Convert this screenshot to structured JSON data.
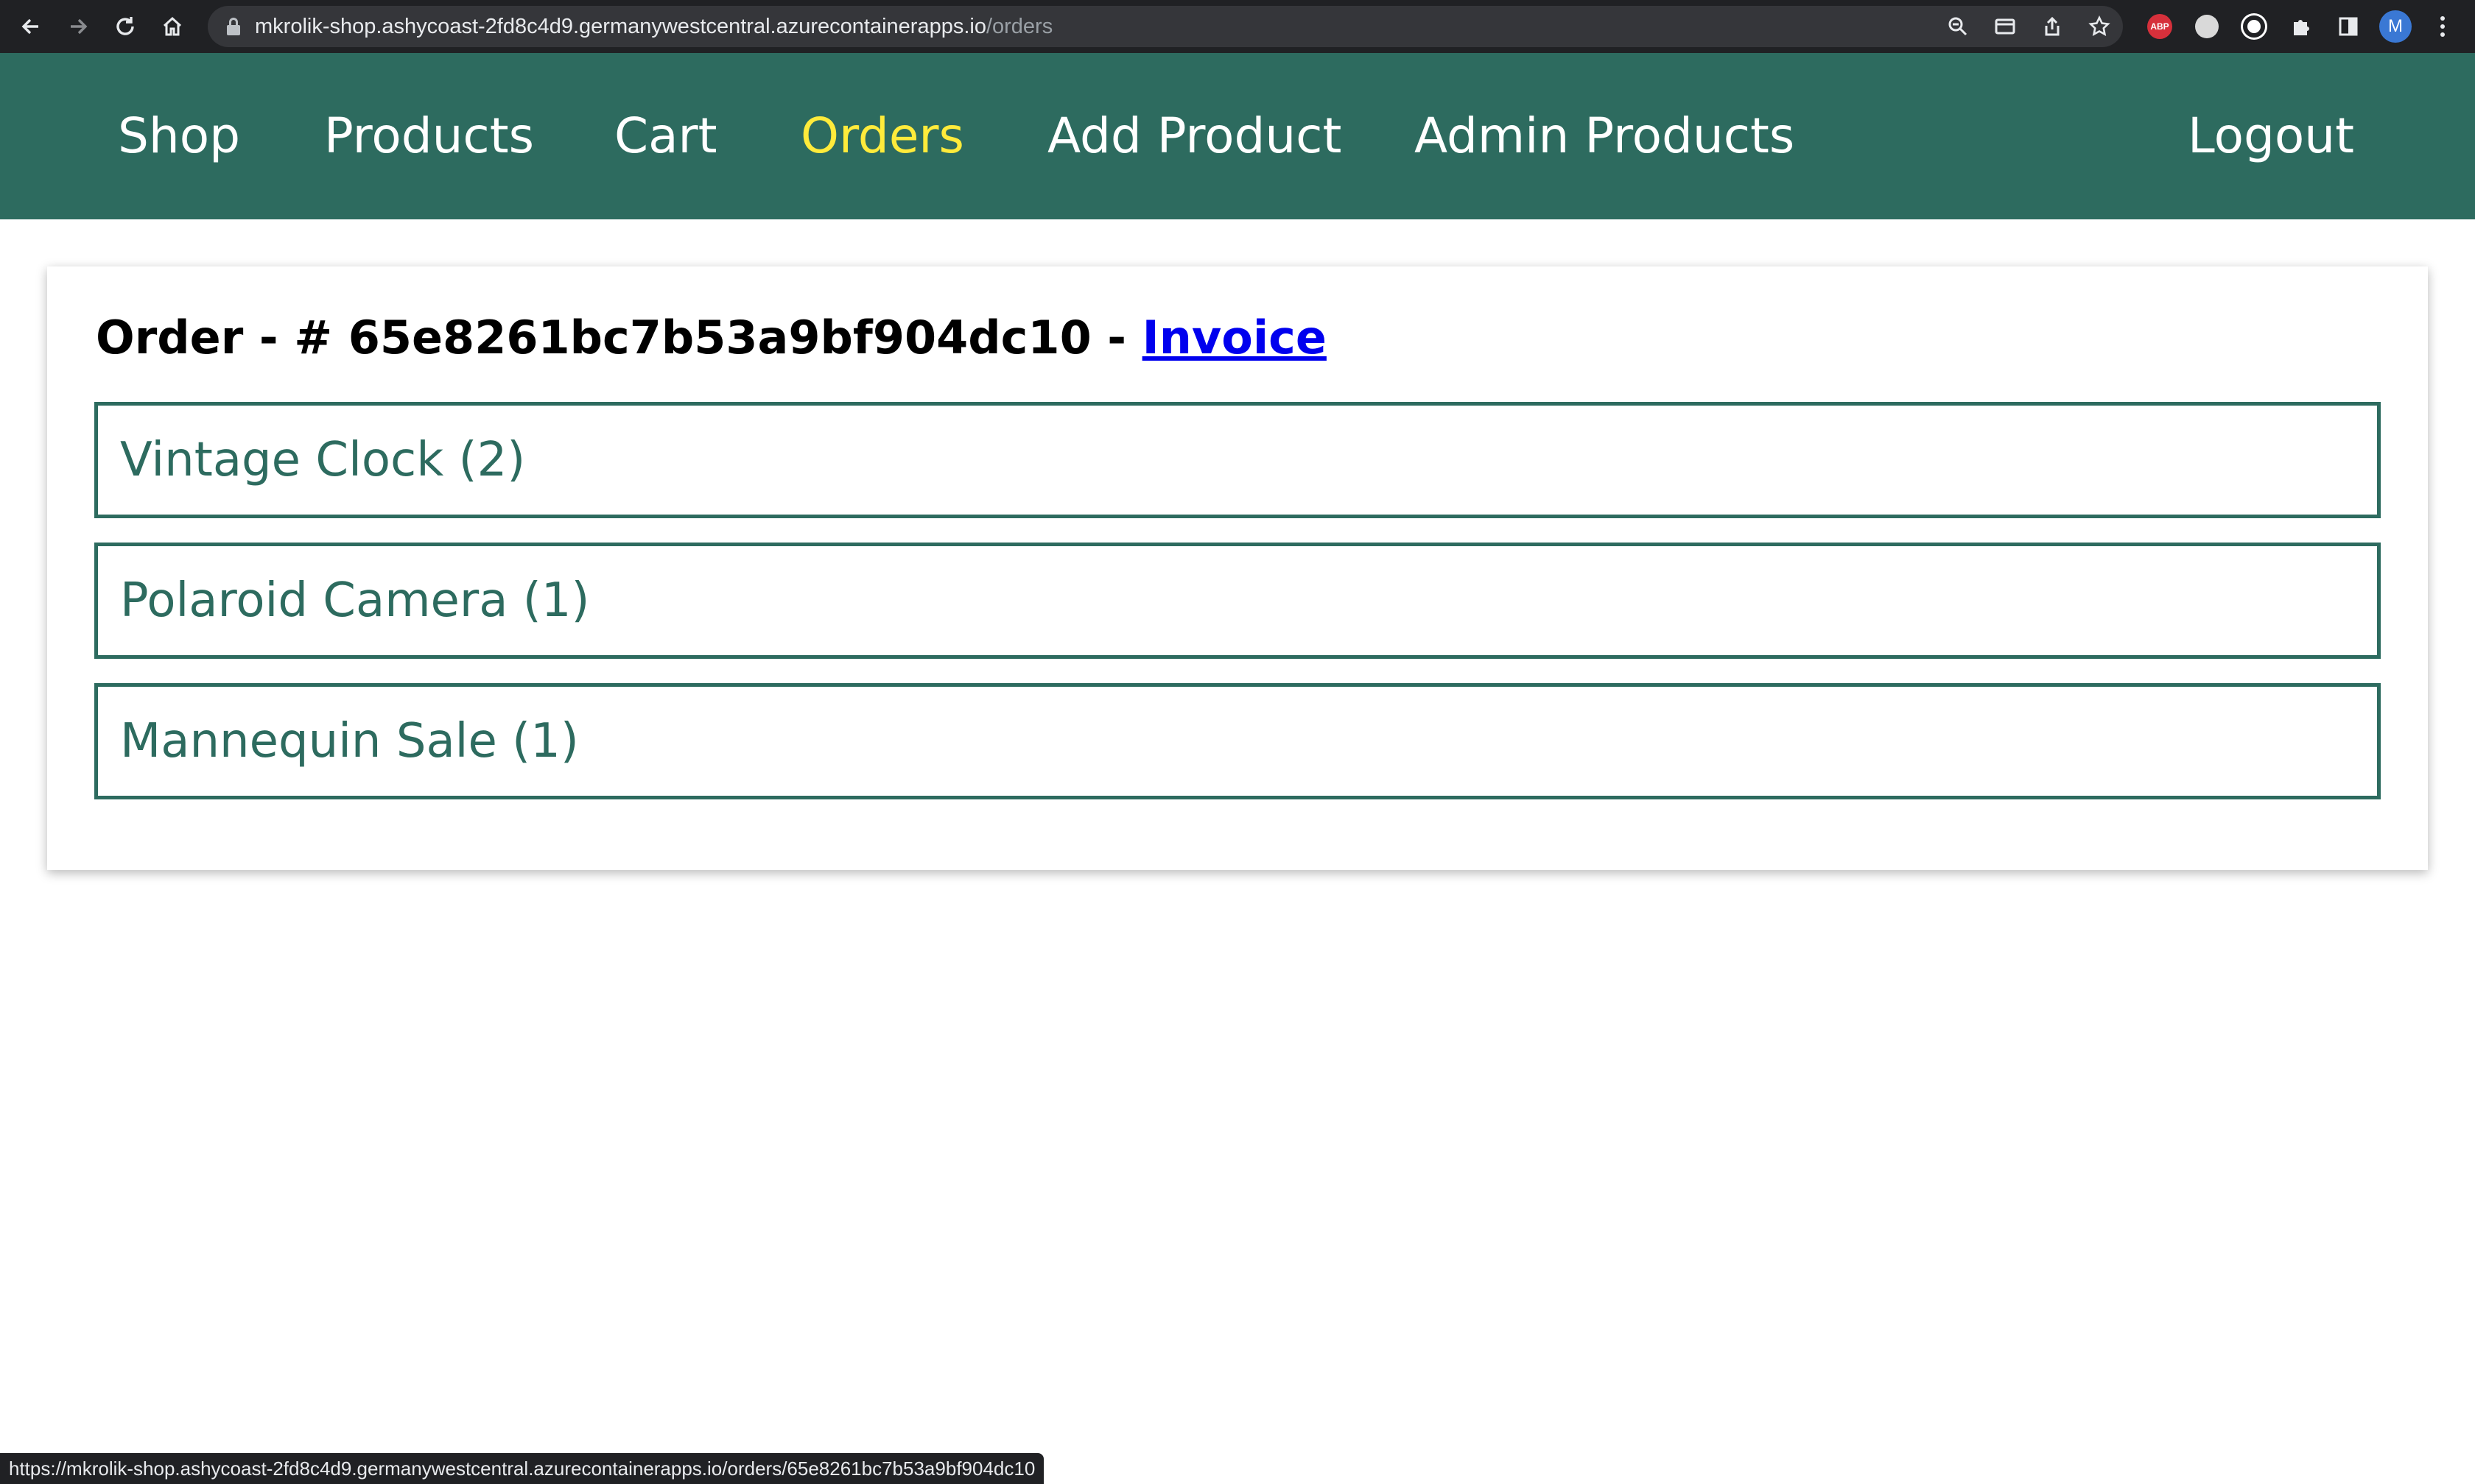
{
  "browser": {
    "url_host": "mkrolik-shop.ashycoast-2fd8c4d9.germanywestcentral.azurecontainerapps.io",
    "url_path": "/orders",
    "profile_initial": "M",
    "abp_label": "ABP",
    "status_url": "https://mkrolik-shop.ashycoast-2fd8c4d9.germanywestcentral.azurecontainerapps.io/orders/65e8261bc7b53a9bf904dc10"
  },
  "nav": {
    "shop": "Shop",
    "products": "Products",
    "cart": "Cart",
    "orders": "Orders",
    "add_product": "Add Product",
    "admin_products": "Admin Products",
    "logout": "Logout",
    "active": "Orders"
  },
  "order": {
    "prefix": "Order - # 65e8261bc7b53a9bf904dc10 - ",
    "invoice_label": "Invoice",
    "items": [
      {
        "label": "Vintage Clock (2)"
      },
      {
        "label": "Polaroid Camera (1)"
      },
      {
        "label": "Mannequin Sale (1)"
      }
    ]
  },
  "colors": {
    "header_bg": "#2d6b5f",
    "active_link": "#ffeb3b",
    "item_border": "#2d6b5f",
    "invoice_link": "#0000ee"
  }
}
